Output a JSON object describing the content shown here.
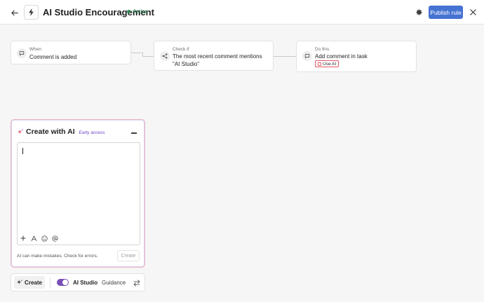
{
  "header": {
    "title": "AI Studio Encouragement",
    "status": "Active",
    "publish_label": "Publish rule"
  },
  "workflow": {
    "trigger": {
      "small": "When",
      "main": "Comment is added"
    },
    "condition": {
      "small": "Check if",
      "line1": "The most recent comment mentions",
      "line2": "\"AI Studio\""
    },
    "action": {
      "small": "Do this",
      "main": "Add comment in task",
      "badge": "Use AI"
    }
  },
  "ai_panel": {
    "title": "Create with AI",
    "badge": "Early access",
    "input_value": "",
    "disclaimer": "AI can make mistakes. Check for errors.",
    "submit_label": "Create"
  },
  "bottom_bar": {
    "create_label": "Create",
    "toggle_label": "AI Studio",
    "toggle_on": true,
    "guidance_label": "Guidance"
  },
  "colors": {
    "primary": "#4573d2",
    "active": "#2e8a55",
    "ai_accent": "#6b45c8",
    "ai_badge": "#e35a6a"
  }
}
